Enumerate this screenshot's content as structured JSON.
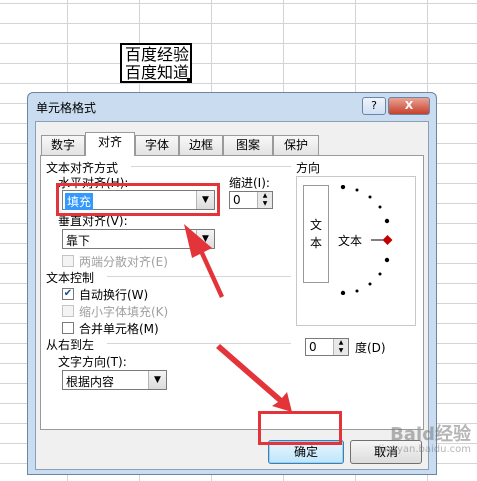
{
  "sheet": {
    "cell_lines": [
      "百度经验",
      "百度知道"
    ]
  },
  "dialog": {
    "title": "单元格格式",
    "help_label": "?",
    "close_label": "X",
    "tabs": [
      "数字",
      "对齐",
      "字体",
      "边框",
      "图案",
      "保护"
    ],
    "active_tab": "对齐",
    "alignment": {
      "group_title": "文本对齐方式",
      "horizontal_label": "水平对齐(H):",
      "horizontal_value": "填充",
      "indent_label": "缩进(I):",
      "indent_value": "0",
      "vertical_label": "垂直对齐(V):",
      "vertical_value": "靠下",
      "distributed_label": "两端分散对齐(E)"
    },
    "text_control": {
      "group_title": "文本控制",
      "wrap_label": "自动换行(W)",
      "wrap_checked": true,
      "shrink_label": "缩小字体填充(K)",
      "merge_label": "合并单元格(M)"
    },
    "rtl": {
      "group_title": "从右到左",
      "direction_label": "文字方向(T):",
      "direction_value": "根据内容"
    },
    "orientation": {
      "group_title": "方向",
      "vertical_text": [
        "文",
        "本"
      ],
      "dial_text": "文本",
      "degrees_value": "0",
      "degrees_label": "度(D)"
    },
    "ok_label": "确定",
    "cancel_label": "取消"
  },
  "watermark": {
    "main": "Baid经验",
    "sub": "jingyan.baidu.com"
  },
  "colors": {
    "highlight": "#e3343a",
    "selection": "#3399ff"
  }
}
